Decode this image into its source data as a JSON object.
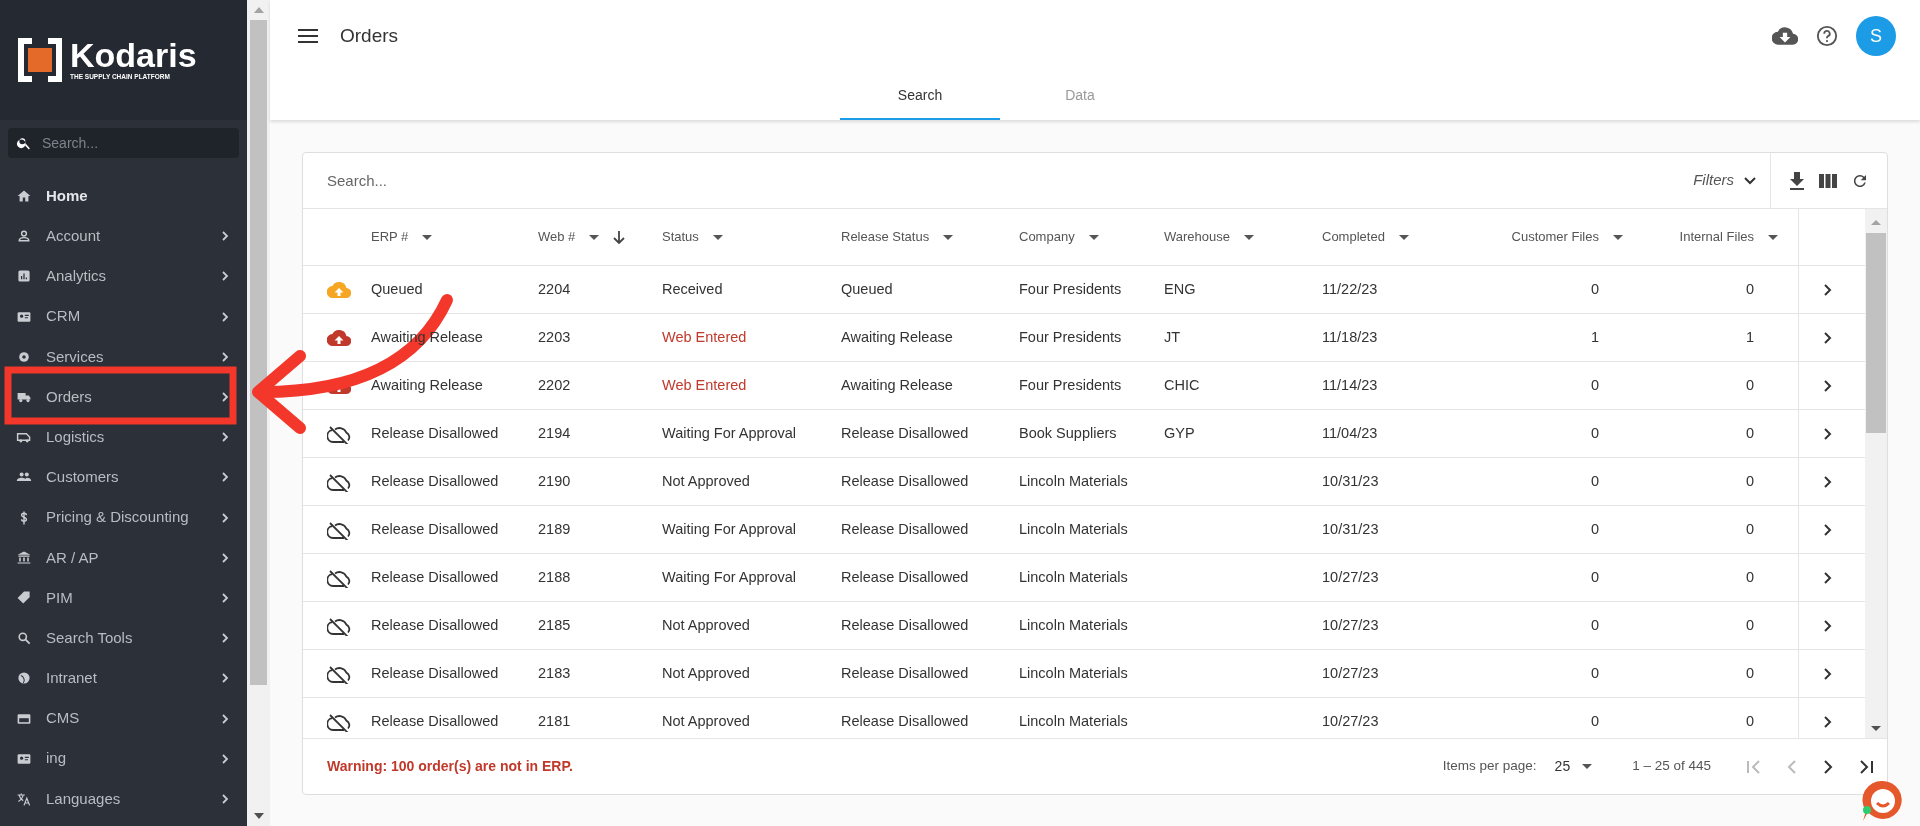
{
  "brand": {
    "name": "Kodaris",
    "tagline": "THE SUPPLY CHAIN PLATFORM"
  },
  "sidebar": {
    "search_placeholder": "Search...",
    "items": [
      {
        "label": "Home",
        "has_submenu": false,
        "bold": true
      },
      {
        "label": "Account",
        "has_submenu": true,
        "bold": false
      },
      {
        "label": "Analytics",
        "has_submenu": true,
        "bold": false
      },
      {
        "label": "CRM",
        "has_submenu": true,
        "bold": false
      },
      {
        "label": "Services",
        "has_submenu": true,
        "bold": false
      },
      {
        "label": "Orders",
        "has_submenu": true,
        "bold": false
      },
      {
        "label": "Logistics",
        "has_submenu": true,
        "bold": false
      },
      {
        "label": "Customers",
        "has_submenu": true,
        "bold": false
      },
      {
        "label": "Pricing & Discounting",
        "has_submenu": true,
        "bold": false
      },
      {
        "label": "AR / AP",
        "has_submenu": true,
        "bold": false
      },
      {
        "label": "PIM",
        "has_submenu": true,
        "bold": false
      },
      {
        "label": "Search Tools",
        "has_submenu": true,
        "bold": false
      },
      {
        "label": "Intranet",
        "has_submenu": true,
        "bold": false
      },
      {
        "label": "CMS",
        "has_submenu": true,
        "bold": false
      },
      {
        "label": "ing",
        "has_submenu": true,
        "bold": false
      },
      {
        "label": "Languages",
        "has_submenu": true,
        "bold": false
      }
    ]
  },
  "header": {
    "title": "Orders",
    "avatar": "S"
  },
  "tabs": [
    {
      "label": "Search",
      "selected": true
    },
    {
      "label": "Data",
      "selected": false
    }
  ],
  "table": {
    "search_placeholder": "Search...",
    "filters": "Filters",
    "columns": [
      {
        "label": "ERP #",
        "sorted": false
      },
      {
        "label": "Web #",
        "sorted": true
      },
      {
        "label": "Status",
        "sorted": false
      },
      {
        "label": "Release Status",
        "sorted": false
      },
      {
        "label": "Company",
        "sorted": false
      },
      {
        "label": "Warehouse",
        "sorted": false
      },
      {
        "label": "Completed",
        "sorted": false
      },
      {
        "label": "Customer Files",
        "sorted": false
      },
      {
        "label": "Internal Files",
        "sorted": false
      }
    ],
    "rows": [
      {
        "kind": "queued",
        "status_warning": false,
        "cells": [
          "Queued",
          "2204",
          "Received",
          "Queued",
          "Four Presidents",
          "ENG",
          "11/22/23",
          "0",
          "0"
        ]
      },
      {
        "kind": "awaiting",
        "status_warning": true,
        "cells": [
          "Awaiting Release",
          "2203",
          "Web Entered",
          "Awaiting Release",
          "Four Presidents",
          "JT",
          "11/18/23",
          "1",
          "1"
        ]
      },
      {
        "kind": "awaiting",
        "status_warning": true,
        "cells": [
          "Awaiting Release",
          "2202",
          "Web Entered",
          "Awaiting Release",
          "Four Presidents",
          "CHIC",
          "11/14/23",
          "0",
          "0"
        ]
      },
      {
        "kind": "disallowed",
        "status_warning": false,
        "cells": [
          "Release Disallowed",
          "2194",
          "Waiting For Approval",
          "Release Disallowed",
          "Book Suppliers",
          "GYP",
          "11/04/23",
          "0",
          "0"
        ]
      },
      {
        "kind": "disallowed",
        "status_warning": false,
        "cells": [
          "Release Disallowed",
          "2190",
          "Not Approved",
          "Release Disallowed",
          "Lincoln Materials",
          "",
          "10/31/23",
          "0",
          "0"
        ]
      },
      {
        "kind": "disallowed",
        "status_warning": false,
        "cells": [
          "Release Disallowed",
          "2189",
          "Waiting For Approval",
          "Release Disallowed",
          "Lincoln Materials",
          "",
          "10/31/23",
          "0",
          "0"
        ]
      },
      {
        "kind": "disallowed",
        "status_warning": false,
        "cells": [
          "Release Disallowed",
          "2188",
          "Waiting For Approval",
          "Release Disallowed",
          "Lincoln Materials",
          "",
          "10/27/23",
          "0",
          "0"
        ]
      },
      {
        "kind": "disallowed",
        "status_warning": false,
        "cells": [
          "Release Disallowed",
          "2185",
          "Not Approved",
          "Release Disallowed",
          "Lincoln Materials",
          "",
          "10/27/23",
          "0",
          "0"
        ]
      },
      {
        "kind": "disallowed",
        "status_warning": false,
        "cells": [
          "Release Disallowed",
          "2183",
          "Not Approved",
          "Release Disallowed",
          "Lincoln Materials",
          "",
          "10/27/23",
          "0",
          "0"
        ]
      },
      {
        "kind": "disallowed",
        "status_warning": false,
        "cells": [
          "Release Disallowed",
          "2181",
          "Not Approved",
          "Release Disallowed",
          "Lincoln Materials",
          "",
          "10/27/23",
          "0",
          "0"
        ]
      }
    ],
    "warning": "Warning: 100 order(s) are not in ERP.",
    "pagination": {
      "label": "Items per page:",
      "page_size": "25",
      "range": "1 – 25 of 445"
    }
  }
}
